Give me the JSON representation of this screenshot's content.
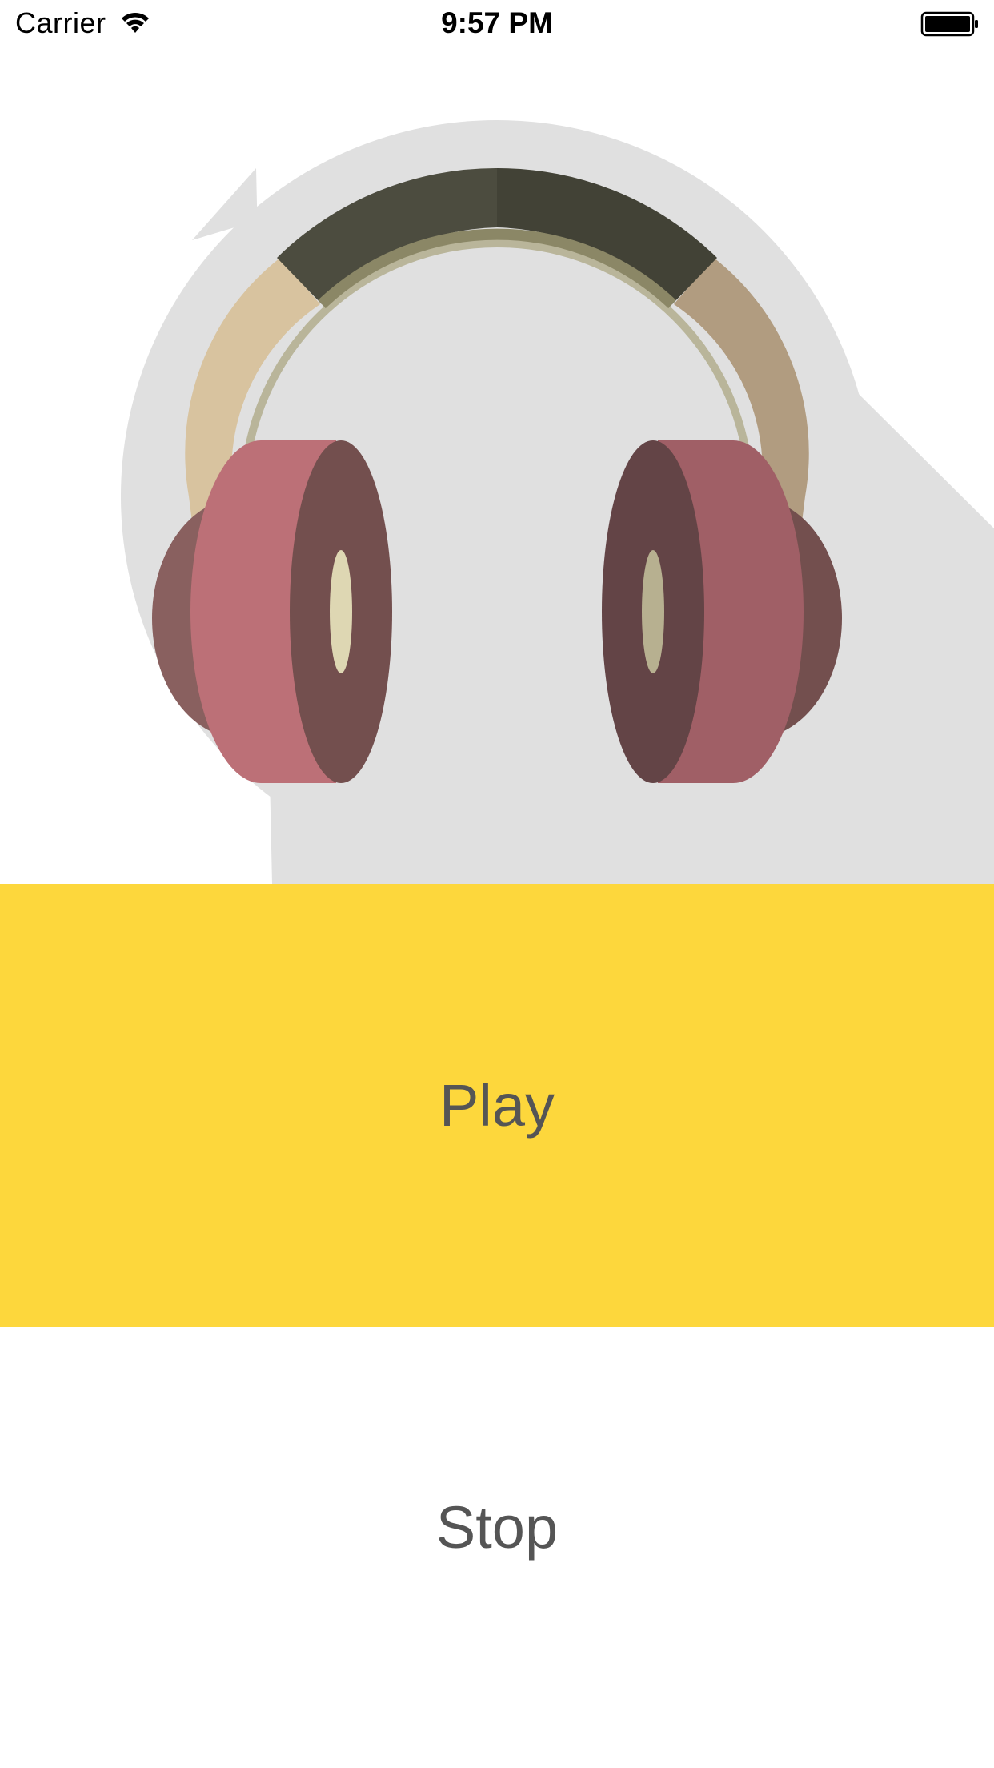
{
  "status_bar": {
    "carrier": "Carrier",
    "time": "9:57 PM",
    "icons": [
      "wifi-icon",
      "battery-icon"
    ]
  },
  "artwork": {
    "icon": "headphones-icon",
    "background_color": "#e0e0e0"
  },
  "controls": {
    "play_label": "Play",
    "play_background": "#fdd73c",
    "stop_label": "Stop",
    "stop_background": "#ffffff",
    "label_color": "#555555"
  }
}
